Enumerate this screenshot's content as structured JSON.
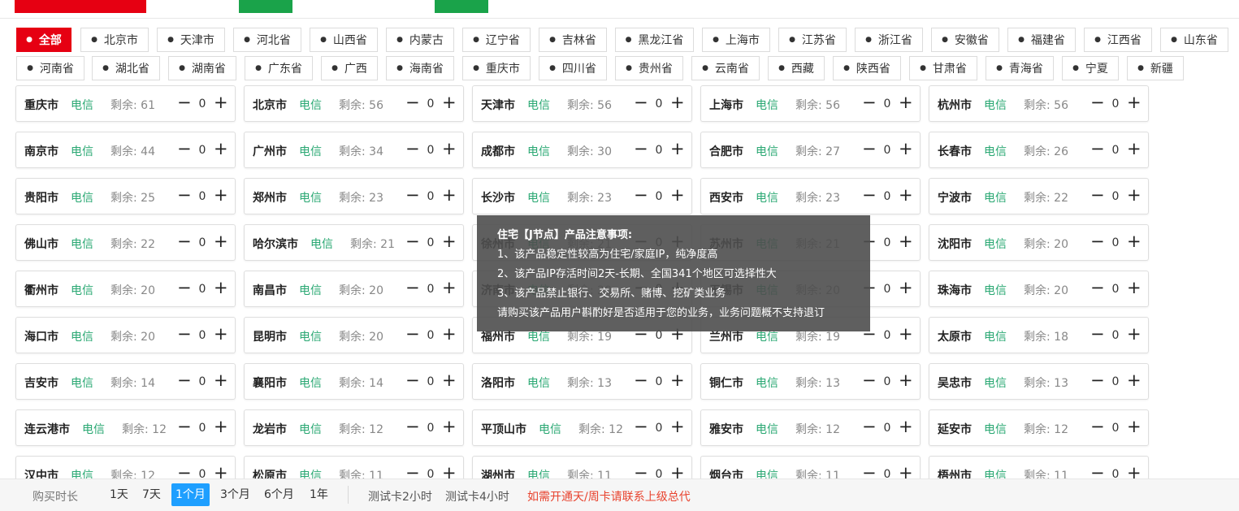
{
  "provinces": [
    {
      "label": "全部",
      "active": true
    },
    {
      "label": "北京市"
    },
    {
      "label": "天津市"
    },
    {
      "label": "河北省"
    },
    {
      "label": "山西省"
    },
    {
      "label": "内蒙古"
    },
    {
      "label": "辽宁省"
    },
    {
      "label": "吉林省"
    },
    {
      "label": "黑龙江省"
    },
    {
      "label": "上海市"
    },
    {
      "label": "江苏省"
    },
    {
      "label": "浙江省"
    },
    {
      "label": "安徽省"
    },
    {
      "label": "福建省"
    },
    {
      "label": "江西省"
    },
    {
      "label": "山东省"
    },
    {
      "label": "河南省"
    },
    {
      "label": "湖北省"
    },
    {
      "label": "湖南省"
    },
    {
      "label": "广东省"
    },
    {
      "label": "广西"
    },
    {
      "label": "海南省"
    },
    {
      "label": "重庆市"
    },
    {
      "label": "四川省"
    },
    {
      "label": "贵州省"
    },
    {
      "label": "云南省"
    },
    {
      "label": "西藏"
    },
    {
      "label": "陕西省"
    },
    {
      "label": "甘肃省"
    },
    {
      "label": "青海省"
    },
    {
      "label": "宁夏"
    },
    {
      "label": "新疆"
    }
  ],
  "cities": [
    {
      "name": "重庆市",
      "isp": "电信",
      "remaining": "剩余: 61",
      "qty": "0"
    },
    {
      "name": "北京市",
      "isp": "电信",
      "remaining": "剩余: 56",
      "qty": "0"
    },
    {
      "name": "天津市",
      "isp": "电信",
      "remaining": "剩余: 56",
      "qty": "0"
    },
    {
      "name": "上海市",
      "isp": "电信",
      "remaining": "剩余: 56",
      "qty": "0"
    },
    {
      "name": "杭州市",
      "isp": "电信",
      "remaining": "剩余: 56",
      "qty": "0"
    },
    {
      "name": "南京市",
      "isp": "电信",
      "remaining": "剩余: 44",
      "qty": "0"
    },
    {
      "name": "广州市",
      "isp": "电信",
      "remaining": "剩余: 34",
      "qty": "0"
    },
    {
      "name": "成都市",
      "isp": "电信",
      "remaining": "剩余: 30",
      "qty": "0"
    },
    {
      "name": "合肥市",
      "isp": "电信",
      "remaining": "剩余: 27",
      "qty": "0"
    },
    {
      "name": "长春市",
      "isp": "电信",
      "remaining": "剩余: 26",
      "qty": "0"
    },
    {
      "name": "贵阳市",
      "isp": "电信",
      "remaining": "剩余: 25",
      "qty": "0"
    },
    {
      "name": "郑州市",
      "isp": "电信",
      "remaining": "剩余: 23",
      "qty": "0"
    },
    {
      "name": "长沙市",
      "isp": "电信",
      "remaining": "剩余: 23",
      "qty": "0"
    },
    {
      "name": "西安市",
      "isp": "电信",
      "remaining": "剩余: 23",
      "qty": "0"
    },
    {
      "name": "宁波市",
      "isp": "电信",
      "remaining": "剩余: 22",
      "qty": "0"
    },
    {
      "name": "佛山市",
      "isp": "电信",
      "remaining": "剩余: 22",
      "qty": "0"
    },
    {
      "name": "哈尔滨市",
      "isp": "电信",
      "remaining": "剩余: 21",
      "qty": "0"
    },
    {
      "name": "徐州市",
      "isp": "电信",
      "remaining": "剩余: 21",
      "qty": "0"
    },
    {
      "name": "苏州市",
      "isp": "电信",
      "remaining": "剩余: 21",
      "qty": "0"
    },
    {
      "name": "沈阳市",
      "isp": "电信",
      "remaining": "剩余: 20",
      "qty": "0"
    },
    {
      "name": "衢州市",
      "isp": "电信",
      "remaining": "剩余: 20",
      "qty": "0"
    },
    {
      "name": "南昌市",
      "isp": "电信",
      "remaining": "剩余: 20",
      "qty": "0"
    },
    {
      "name": "济南市",
      "isp": "电信",
      "remaining": "剩余: 20",
      "qty": "0"
    },
    {
      "name": "无锡市",
      "isp": "电信",
      "remaining": "剩余: 20",
      "qty": "0"
    },
    {
      "name": "珠海市",
      "isp": "电信",
      "remaining": "剩余: 20",
      "qty": "0"
    },
    {
      "name": "海口市",
      "isp": "电信",
      "remaining": "剩余: 20",
      "qty": "0"
    },
    {
      "name": "昆明市",
      "isp": "电信",
      "remaining": "剩余: 20",
      "qty": "0"
    },
    {
      "name": "福州市",
      "isp": "电信",
      "remaining": "剩余: 19",
      "qty": "0"
    },
    {
      "name": "兰州市",
      "isp": "电信",
      "remaining": "剩余: 19",
      "qty": "0"
    },
    {
      "name": "太原市",
      "isp": "电信",
      "remaining": "剩余: 18",
      "qty": "0"
    },
    {
      "name": "吉安市",
      "isp": "电信",
      "remaining": "剩余: 14",
      "qty": "0"
    },
    {
      "name": "襄阳市",
      "isp": "电信",
      "remaining": "剩余: 14",
      "qty": "0"
    },
    {
      "name": "洛阳市",
      "isp": "电信",
      "remaining": "剩余: 13",
      "qty": "0"
    },
    {
      "name": "铜仁市",
      "isp": "电信",
      "remaining": "剩余: 13",
      "qty": "0"
    },
    {
      "name": "吴忠市",
      "isp": "电信",
      "remaining": "剩余: 13",
      "qty": "0"
    },
    {
      "name": "连云港市",
      "isp": "电信",
      "remaining": "剩余: 12",
      "qty": "0"
    },
    {
      "name": "龙岩市",
      "isp": "电信",
      "remaining": "剩余: 12",
      "qty": "0"
    },
    {
      "name": "平顶山市",
      "isp": "电信",
      "remaining": "剩余: 12",
      "qty": "0"
    },
    {
      "name": "雅安市",
      "isp": "电信",
      "remaining": "剩余: 12",
      "qty": "0"
    },
    {
      "name": "延安市",
      "isp": "电信",
      "remaining": "剩余: 12",
      "qty": "0"
    },
    {
      "name": "汉中市",
      "isp": "电信",
      "remaining": "剩余: 12",
      "qty": "0"
    },
    {
      "name": "松原市",
      "isp": "电信",
      "remaining": "剩余: 11",
      "qty": "0"
    },
    {
      "name": "湖州市",
      "isp": "电信",
      "remaining": "剩余: 11",
      "qty": "0"
    },
    {
      "name": "烟台市",
      "isp": "电信",
      "remaining": "剩余: 11",
      "qty": "0"
    },
    {
      "name": "梧州市",
      "isp": "电信",
      "remaining": "剩余: 11",
      "qty": "0"
    }
  ],
  "tooltip": {
    "title": "住宅【J节点】产品注意事项:",
    "lines": [
      "1、该产品稳定性较高为住宅/家庭IP，纯净度高",
      "2、该产品IP存活时间2天-长期、全国341个地区可选择性大",
      "3、该产品禁止银行、交易所、赌博、挖矿类业务",
      "请购买该产品用户斟酌好是否适用于您的业务，业务问题概不支持退订"
    ]
  },
  "bottom": {
    "label": "购买时长",
    "durations": [
      {
        "label": "1天"
      },
      {
        "label": "7天"
      },
      {
        "label": "1个月",
        "active": true
      },
      {
        "label": "3个月"
      },
      {
        "label": "6个月"
      },
      {
        "label": "1年"
      }
    ],
    "trials": [
      "测试卡2小时",
      "测试卡4小时"
    ],
    "notice": "如需开通天/周卡请联系上级总代"
  },
  "colors": {
    "accent_red": "#e60012",
    "isp_green": "#2aa873",
    "active_blue": "#1e9fff",
    "notice_red": "#e8432e"
  }
}
